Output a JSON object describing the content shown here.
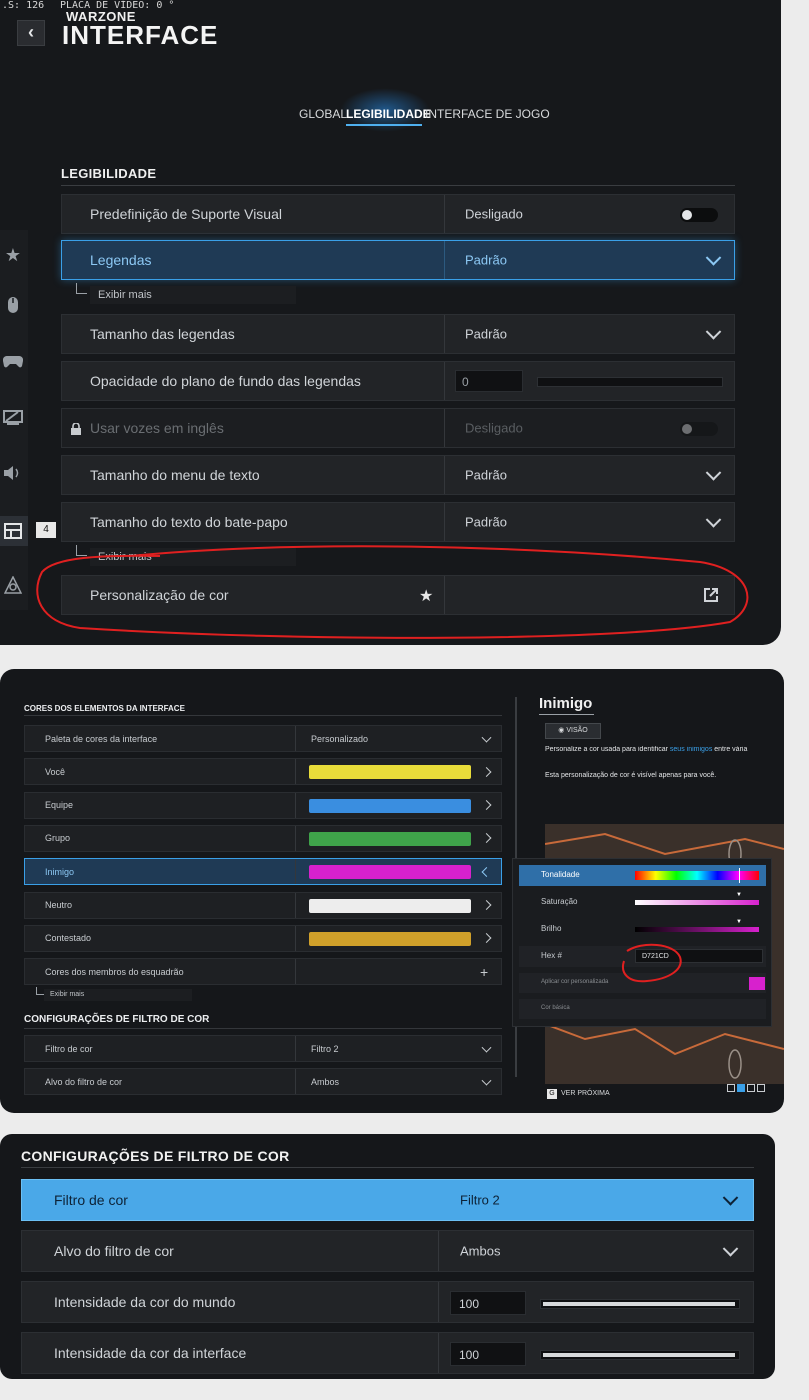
{
  "status_bar": {
    "fps_text": ".S: 126",
    "gpu_text": "PLACA DE VÍDEO: 0 °"
  },
  "header": {
    "brand": "WARZONE",
    "title": "INTERFACE",
    "back_label": "‹"
  },
  "tabs": [
    {
      "label": "GLOBAL",
      "active": false
    },
    {
      "label": "LEGIBILIDADE",
      "active": true
    },
    {
      "label": "INTERFACE DE JOGO",
      "active": false
    }
  ],
  "legibilidade": {
    "section_title": "LEGIBILIDADE",
    "rows": [
      {
        "label": "Predefinição de Suporte Visual",
        "value": "Desligado",
        "control": "toggle"
      },
      {
        "label": "Legendas",
        "value": "Padrão",
        "control": "dropdown",
        "selected": true
      },
      {
        "label": "Tamanho das legendas",
        "value": "Padrão",
        "control": "dropdown"
      },
      {
        "label": "Opacidade do plano de fundo das legendas",
        "value": "0",
        "control": "slider"
      },
      {
        "label": "Usar vozes em inglês",
        "value": "Desligado",
        "control": "toggle",
        "locked": true
      },
      {
        "label": "Tamanho do menu de texto",
        "value": "Padrão",
        "control": "dropdown"
      },
      {
        "label": "Tamanho do texto do bate-papo",
        "value": "Padrão",
        "control": "dropdown"
      },
      {
        "label": "Personalização de cor",
        "value": "",
        "control": "external"
      }
    ],
    "show_more_1": "Exibir mais",
    "show_more_2": "Exibir mais",
    "badge": "4"
  },
  "sidebar_icons": [
    "star-icon",
    "mouse-icon",
    "gamepad-icon",
    "monitor-icon",
    "speaker-icon",
    "interface-icon",
    "network-icon"
  ],
  "colors_panel": {
    "section_title": "CORES DOS ELEMENTOS DA INTERFACE",
    "rows": [
      {
        "label": "Paleta de cores da interface",
        "value": "Personalizado"
      },
      {
        "label": "Você",
        "color": "#e8dc3a"
      },
      {
        "label": "Equipe",
        "color": "#3a8ee0"
      },
      {
        "label": "Grupo",
        "color": "#3fa34a"
      },
      {
        "label": "Inimigo",
        "color": "#d721cd"
      },
      {
        "label": "Neutro",
        "color": "#ededed"
      },
      {
        "label": "Contestado",
        "color": "#d0a02a"
      },
      {
        "label": "Cores dos membros do esquadrão",
        "value": "+"
      }
    ],
    "show_more": "Exibir mais",
    "filter_title": "CONFIGURAÇÕES DE FILTRO DE COR",
    "filter_rows": [
      {
        "label": "Filtro de cor",
        "value": "Filtro 2"
      },
      {
        "label": "Alvo do filtro de cor",
        "value": "Ambos"
      }
    ],
    "preview": {
      "title": "Inimigo",
      "vision_button": "VISÃO",
      "desc1_a": "Personalize a cor usada para identificar ",
      "desc1_link": "seus inimigos",
      "desc1_b": " entre vária",
      "desc2": "Esta personalização de cor é visível apenas para você.",
      "next_key": "G",
      "next_label": "VER PRÓXIMA"
    },
    "picker": {
      "hue_label": "Tonalidade",
      "sat_label": "Saturação",
      "bright_label": "Brilho",
      "hex_label": "Hex #",
      "hex_value": "D721CD",
      "apply_label": "Aplicar cor personalizada",
      "basic_label": "Cor básica",
      "custom_color": "#d721cd"
    }
  },
  "filter_panel": {
    "section_title": "CONFIGURAÇÕES DE FILTRO DE COR",
    "rows": [
      {
        "label": "Filtro de cor",
        "value": "Filtro 2",
        "control": "dropdown",
        "selected": true
      },
      {
        "label": "Alvo do filtro de cor",
        "value": "Ambos",
        "control": "dropdown"
      },
      {
        "label": "Intensidade da cor do mundo",
        "value": "100",
        "control": "slider"
      },
      {
        "label": "Intensidade da cor da interface",
        "value": "100",
        "control": "slider"
      }
    ]
  },
  "colors": {
    "accent": "#3aa0e8",
    "selected_bg": "#1f3a55",
    "annotation_red": "#e02020"
  }
}
